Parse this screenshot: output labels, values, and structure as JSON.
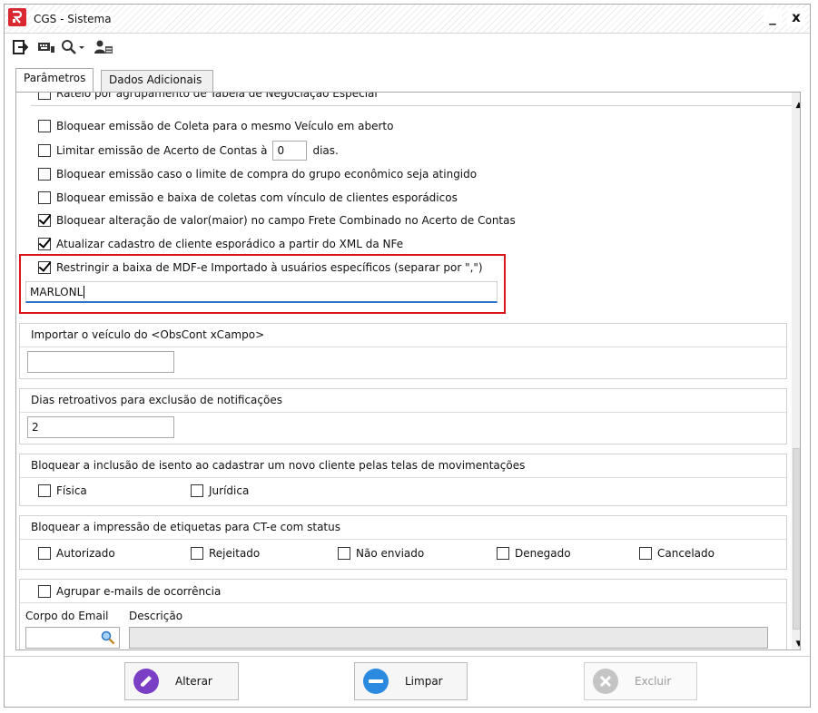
{
  "window": {
    "title": "CGS - Sistema",
    "minimize_label": "_",
    "close_label": "x"
  },
  "toolbar": {
    "icons": [
      "exit-icon",
      "keyboard-icon",
      "search-dropdown-icon",
      "user-icon"
    ]
  },
  "tabs": [
    {
      "label": "Parâmetros",
      "active": true
    },
    {
      "label": "Dados Adicionais",
      "active": false
    }
  ],
  "options": [
    {
      "label": "Rateio por agrupamento de Tabela de Negociação Especial",
      "checked": false
    },
    {
      "label": "Bloquear emissão de Coleta para o mesmo Veículo em aberto",
      "checked": false
    },
    {
      "label_before": "Limitar emissão de Acerto de Contas à",
      "value": "0",
      "label_after": "dias.",
      "checked": false
    },
    {
      "label": "Bloquear emissão caso o limite de compra do grupo econômico seja atingido",
      "checked": false
    },
    {
      "label": "Bloquear emissão e baixa de coletas com vínculo de clientes esporádicos",
      "checked": false
    },
    {
      "label": "Bloquear alteração de valor(maior) no campo Frete Combinado no Acerto de Contas",
      "checked": true
    },
    {
      "label": "Atualizar cadastro de cliente esporádico a partir do XML da NFe",
      "checked": true
    },
    {
      "label": "Restringir a baixa de MDF-e Importado à usuários específicos (separar por \",\")",
      "checked": true
    }
  ],
  "restrict_users": {
    "value": "MARLONL"
  },
  "import_vehicle": {
    "title": "Importar o veículo do <ObsCont xCampo>",
    "value": ""
  },
  "retro_days": {
    "title": "Dias retroativos para exclusão de notificações",
    "value": "2"
  },
  "exempt_block": {
    "title": "Bloquear a inclusão de isento ao cadastrar um novo cliente pelas telas de movimentações",
    "options": [
      {
        "label": "Física",
        "checked": false
      },
      {
        "label": "Jurídica",
        "checked": false
      }
    ]
  },
  "label_block": {
    "title": "Bloquear a impressão de etiquetas para CT-e com status",
    "options": [
      {
        "label": "Autorizado",
        "checked": false
      },
      {
        "label": "Rejeitado",
        "checked": false
      },
      {
        "label": "Não enviado",
        "checked": false
      },
      {
        "label": "Denegado",
        "checked": false
      },
      {
        "label": "Cancelado",
        "checked": false
      }
    ]
  },
  "email_group": {
    "checkbox_label": "Agrupar e-mails de ocorrência",
    "checked": false,
    "body_label": "Corpo do Email",
    "desc_label": "Descrição",
    "body_value": "",
    "desc_value": ""
  },
  "actions": {
    "alterar": "Alterar",
    "limpar": "Limpar",
    "excluir": "Excluir"
  },
  "colors": {
    "accent_blue": "#2a74c9",
    "highlight_red": "#d9141b",
    "brand_red": "#d9282f"
  }
}
